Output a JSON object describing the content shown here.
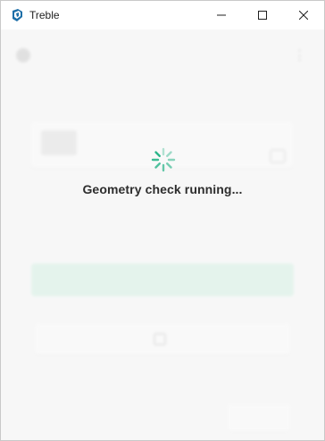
{
  "window": {
    "title": "Treble",
    "icons": {
      "logo": "treble-logo-icon",
      "minimize": "minimize-icon",
      "maximize": "maximize-icon",
      "close": "close-icon"
    }
  },
  "background_ui": {
    "field_label": "",
    "field_value": "",
    "card": {
      "thumbnail_text": "",
      "label": "",
      "text": ""
    },
    "primary_button_label": "",
    "separator_text": "",
    "secondary_button_label": "",
    "support_button_label": ""
  },
  "loading": {
    "message": "Geometry check running...",
    "spinner_color": "#2bb58a"
  }
}
